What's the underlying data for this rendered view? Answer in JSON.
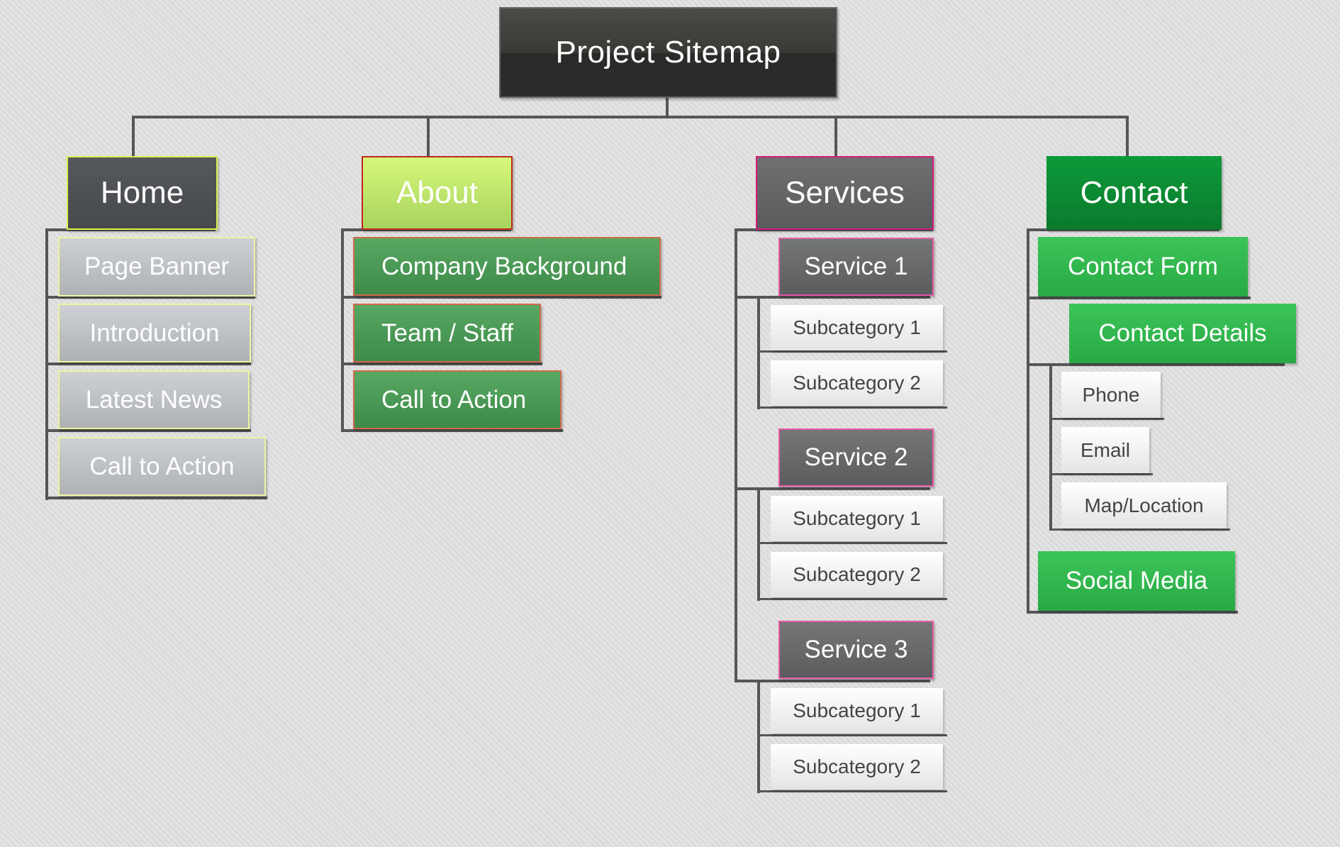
{
  "title": "Project Sitemap",
  "colors": {
    "connector": "#555657",
    "home_border": "#d7f24a",
    "about_border": "#c0281e",
    "services_border": "#d61b7a",
    "contact_fill": "#0a8a32",
    "contact_child_fill": "#30b94e"
  },
  "sections": {
    "home": {
      "label": "Home",
      "children": [
        "Page Banner",
        "Introduction",
        "Latest News",
        "Call to Action"
      ]
    },
    "about": {
      "label": "About",
      "children": [
        "Company Background",
        "Team / Staff",
        "Call to Action"
      ]
    },
    "services": {
      "label": "Services",
      "children": [
        {
          "label": "Service 1",
          "subs": [
            "Subcategory 1",
            "Subcategory 2"
          ]
        },
        {
          "label": "Service 2",
          "subs": [
            "Subcategory 1",
            "Subcategory 2"
          ]
        },
        {
          "label": "Service 3",
          "subs": [
            "Subcategory 1",
            "Subcategory 2"
          ]
        }
      ]
    },
    "contact": {
      "label": "Contact",
      "children": [
        {
          "label": "Contact Form"
        },
        {
          "label": "Contact Details",
          "subs": [
            "Phone",
            "Email",
            "Map/Location"
          ]
        },
        {
          "label": "Social Media"
        }
      ]
    }
  }
}
